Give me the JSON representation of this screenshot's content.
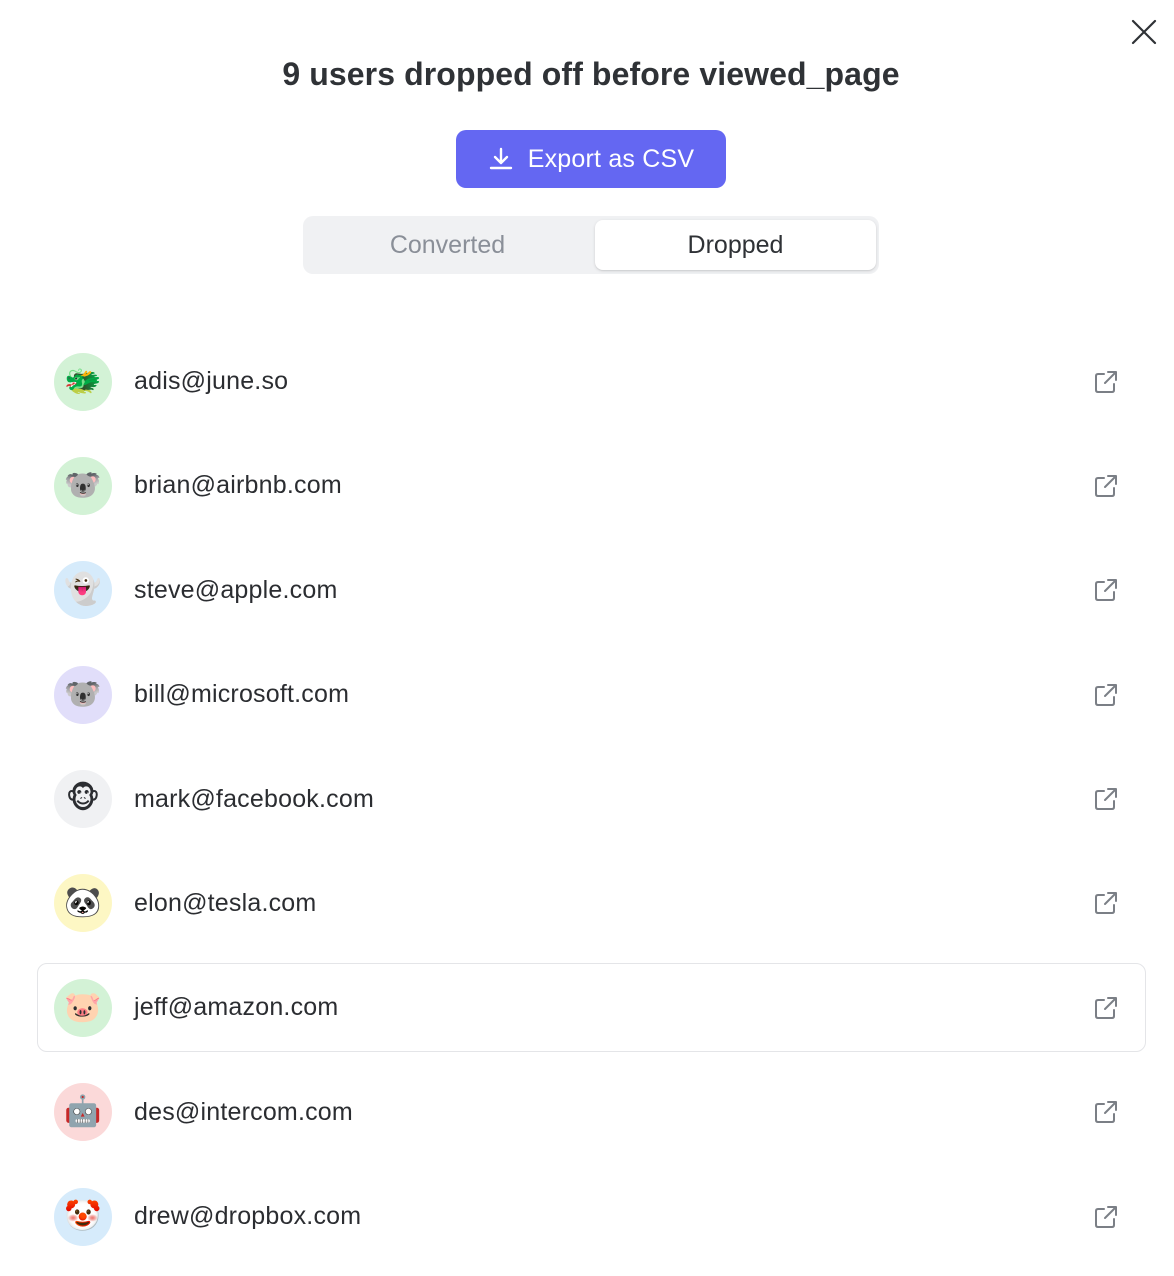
{
  "modal": {
    "title": "9 users dropped off before viewed_page",
    "export_label": "Export as CSV",
    "tabs": [
      {
        "label": "Converted",
        "active": false
      },
      {
        "label": "Dropped",
        "active": true
      }
    ]
  },
  "colors": {
    "accent": "#6467f2",
    "text": "#2b2d31",
    "muted": "#8a8f98"
  },
  "users": [
    {
      "email": "adis@june.so",
      "avatar": "🐲",
      "avatar_bg": "#d3f2d6"
    },
    {
      "email": "brian@airbnb.com",
      "avatar": "🐨",
      "avatar_bg": "#d3f2d6"
    },
    {
      "email": "steve@apple.com",
      "avatar": "👻",
      "avatar_bg": "#d6ebfb"
    },
    {
      "email": "bill@microsoft.com",
      "avatar": "🐨",
      "avatar_bg": "#e1defa"
    },
    {
      "email": "mark@facebook.com",
      "avatar": "🐵",
      "avatar_bg": "#f0f1f3"
    },
    {
      "email": "elon@tesla.com",
      "avatar": "🐼",
      "avatar_bg": "#fdf7c4"
    },
    {
      "email": "jeff@amazon.com",
      "avatar": "🐷",
      "avatar_bg": "#d3f2d6",
      "hovered": true
    },
    {
      "email": "des@intercom.com",
      "avatar": "🤖",
      "avatar_bg": "#fbd9d9"
    },
    {
      "email": "drew@dropbox.com",
      "avatar": "🤡",
      "avatar_bg": "#d6ebfb"
    }
  ],
  "icons": {
    "close": "close-icon",
    "download": "download-icon",
    "external": "external-link-icon"
  }
}
